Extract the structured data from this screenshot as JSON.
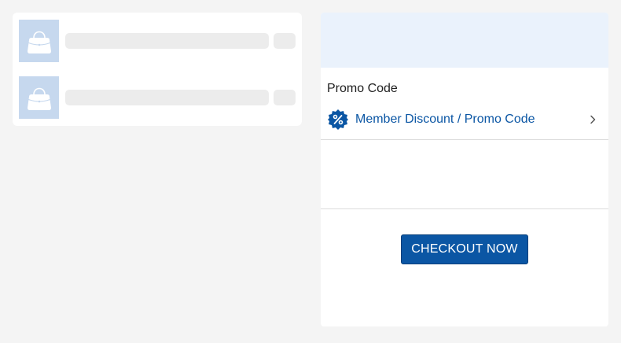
{
  "cart": {
    "items": [
      {
        "thumbnail_icon": "handbag-icon",
        "loading": true
      },
      {
        "thumbnail_icon": "handbag-icon",
        "loading": true
      }
    ]
  },
  "summary": {
    "promo_title": "Promo Code",
    "promo_link_label": "Member Discount / Promo Code",
    "promo_icon": "percent-badge-icon",
    "chevron_icon": "chevron-right-icon",
    "checkout_label": "CHECKOUT NOW"
  },
  "colors": {
    "accent": "#0b56a4",
    "thumbnail_bg": "#c6d8ee",
    "header_bg": "#eaf2fc",
    "page_bg": "#f4f4f4"
  }
}
